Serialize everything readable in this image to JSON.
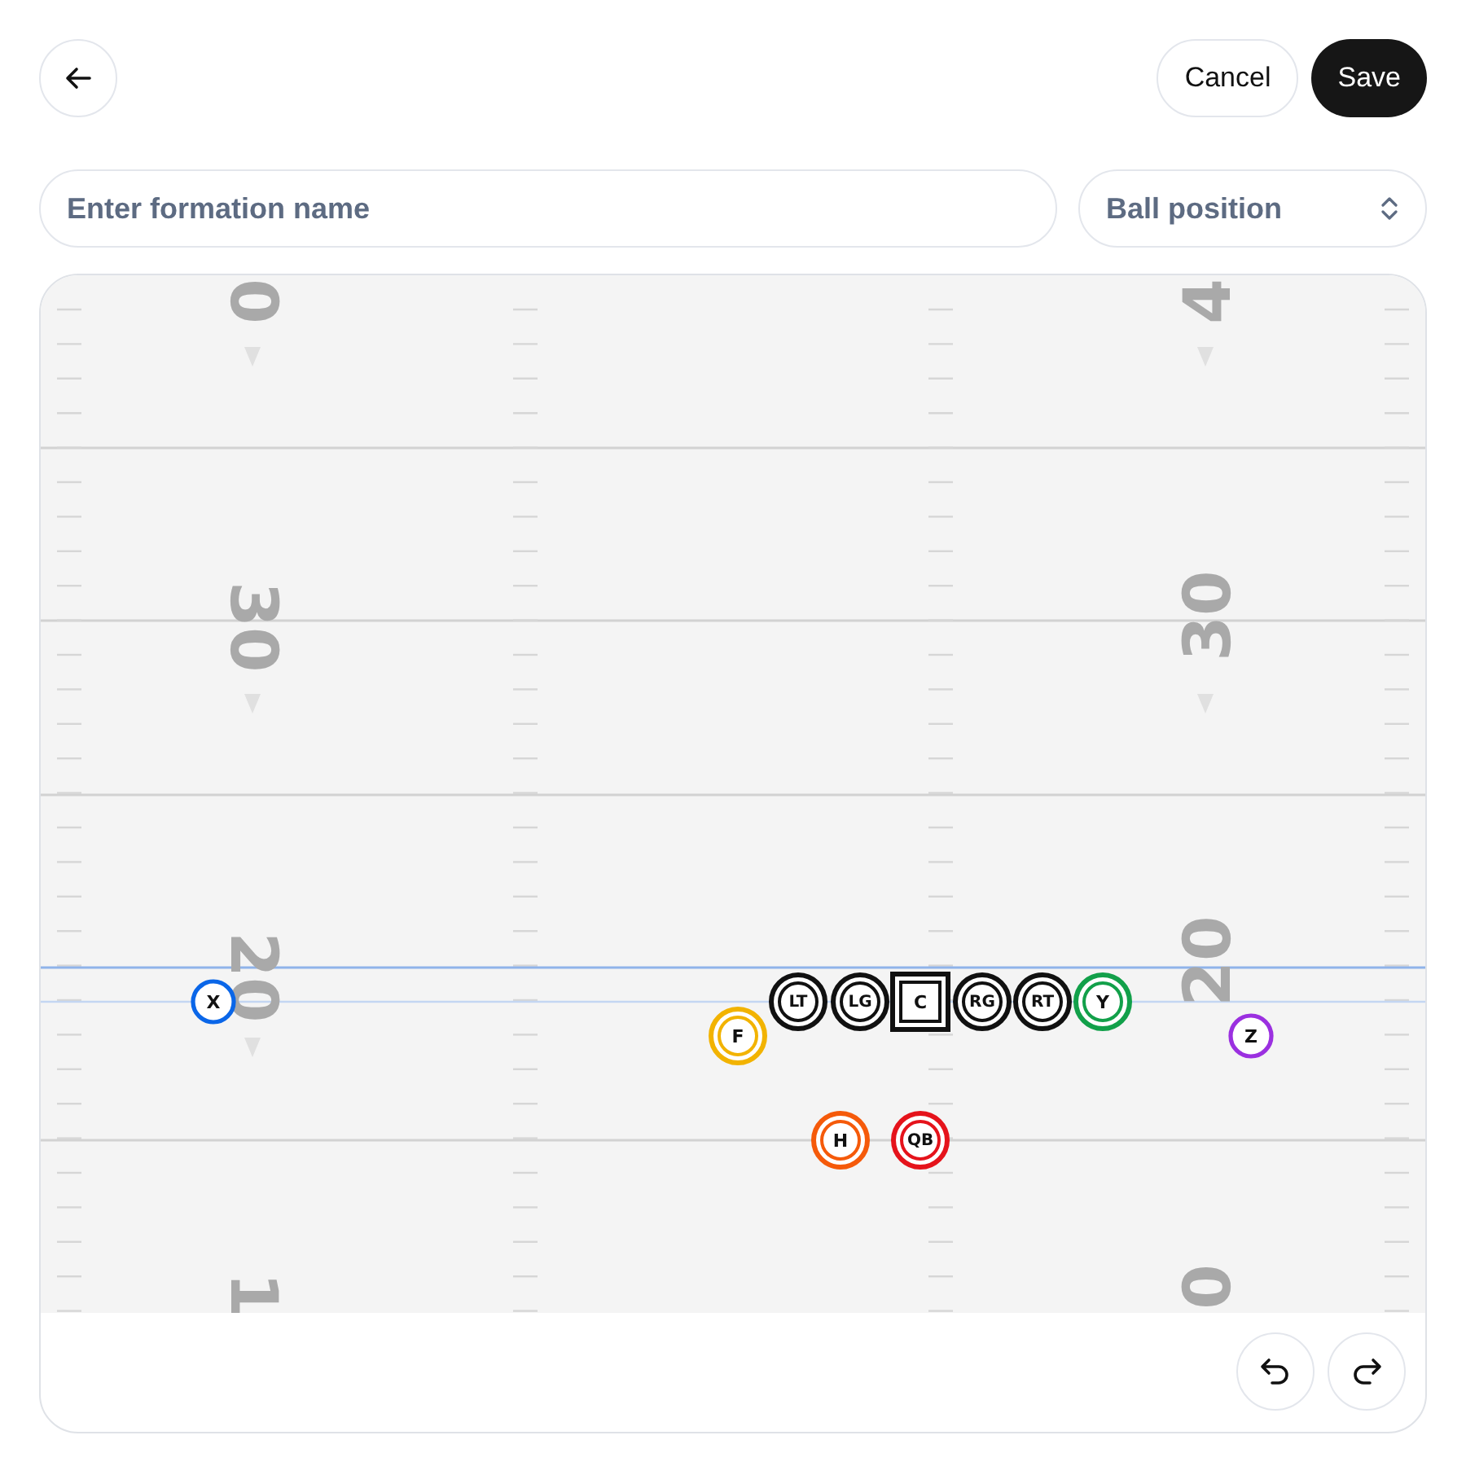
{
  "header": {
    "save": "Save",
    "cancel": "Cancel"
  },
  "formation_name": {
    "placeholder": "Enter formation name"
  },
  "ball_position": {
    "placeholder": "Ball position"
  },
  "field": {
    "left_yard_numbers": [
      "0",
      "30",
      "20",
      "1"
    ],
    "right_yard_numbers": [
      "4",
      "30",
      "20",
      "0"
    ],
    "players": [
      {
        "label": "X",
        "color": "#0a66e8",
        "kind": "single"
      },
      {
        "label": "F",
        "color": "#f2b300",
        "kind": "double"
      },
      {
        "label": "LT",
        "color": "#111111",
        "kind": "double"
      },
      {
        "label": "LG",
        "color": "#111111",
        "kind": "double"
      },
      {
        "label": "C",
        "color": "#111111",
        "kind": "square"
      },
      {
        "label": "RG",
        "color": "#111111",
        "kind": "double"
      },
      {
        "label": "RT",
        "color": "#111111",
        "kind": "double"
      },
      {
        "label": "Y",
        "color": "#12a04a",
        "kind": "double"
      },
      {
        "label": "Z",
        "color": "#9b30e0",
        "kind": "single"
      },
      {
        "label": "H",
        "color": "#f55a0a",
        "kind": "double"
      },
      {
        "label": "QB",
        "color": "#e5131b",
        "kind": "double"
      }
    ]
  }
}
